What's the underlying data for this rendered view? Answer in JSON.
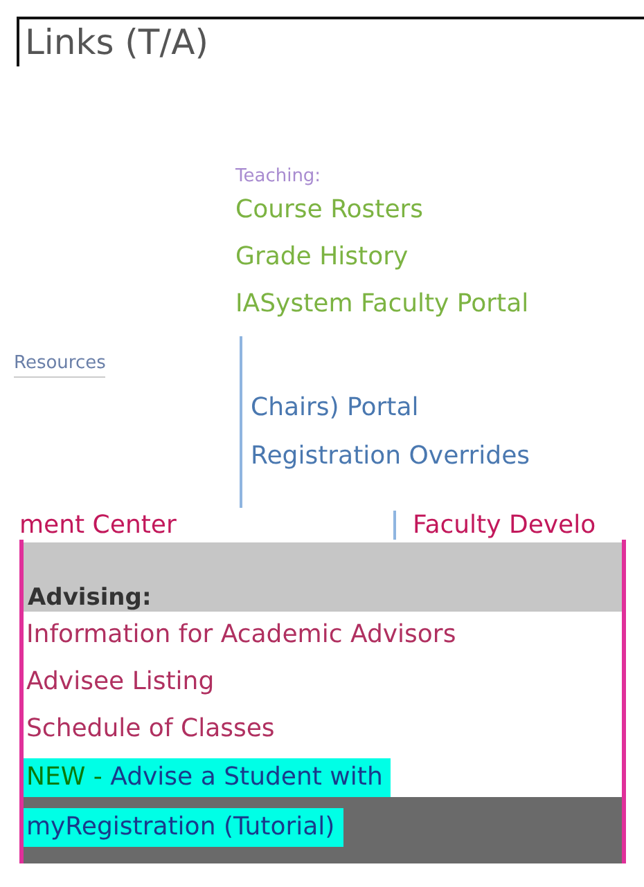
{
  "title": "Links (T/A)",
  "teaching": {
    "heading": "Teaching:",
    "links": [
      "Course Rosters",
      "Grade History",
      "IASystem Faculty Portal"
    ]
  },
  "resources": {
    "heading": "Resources",
    "links": [
      "Chairs) Portal",
      "Registration Overrides"
    ]
  },
  "cut_row": {
    "left": "ment Center",
    "right": "Faculty Develo"
  },
  "advising": {
    "heading": "Advising:",
    "links": [
      "Information for Academic Advisors",
      "Advisee Listing",
      "Schedule of Classes"
    ],
    "new_link": {
      "badge": "NEW -",
      "lines": [
        "Advise a Student with",
        "myRegistration (Tutorial)"
      ]
    }
  }
}
